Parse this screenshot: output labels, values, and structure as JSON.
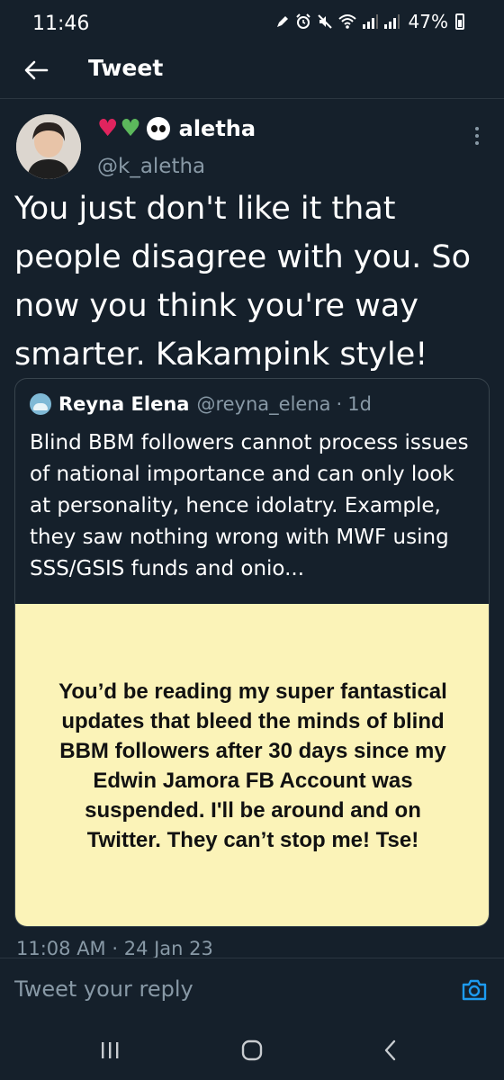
{
  "status_bar": {
    "time": "11:46",
    "battery": "47%"
  },
  "header": {
    "title": "Tweet"
  },
  "tweet": {
    "display_name": "aletha",
    "handle": "@k_aletha",
    "text": "You just don't like it that people disagree with you. So now you think you're way smarter. Kakampink style!",
    "timestamp": "11:08 AM · 24 Jan 23"
  },
  "quoted_tweet": {
    "name": "Reyna Elena",
    "handle": "@reyna_elena",
    "separator": "·",
    "time": "1d",
    "text": "Blind BBM followers cannot process issues of national importance and can only look at personality, hence idolatry. Example, they saw nothing wrong with MWF using SSS/GSIS funds and onio...",
    "image_text": "You’d be reading my super fantastical updates that bleed the minds of blind BBM followers after 30 days since my Edwin Jamora FB Account was suspended. I'll be around and on Twitter. They can’t stop me! Tse!"
  },
  "reply": {
    "placeholder": "Tweet your reply"
  },
  "colors": {
    "background": "#15202b",
    "accent": "#1d9bf0",
    "muted_text": "#8899a6",
    "quote_image_bg": "#fbf3b8"
  },
  "icons": [
    "back-arrow-icon",
    "more-options-icon",
    "camera-icon",
    "recent-apps-icon",
    "home-icon",
    "nav-back-icon",
    "alarm-icon",
    "mute-icon",
    "wifi-icon",
    "signal-icon"
  ]
}
